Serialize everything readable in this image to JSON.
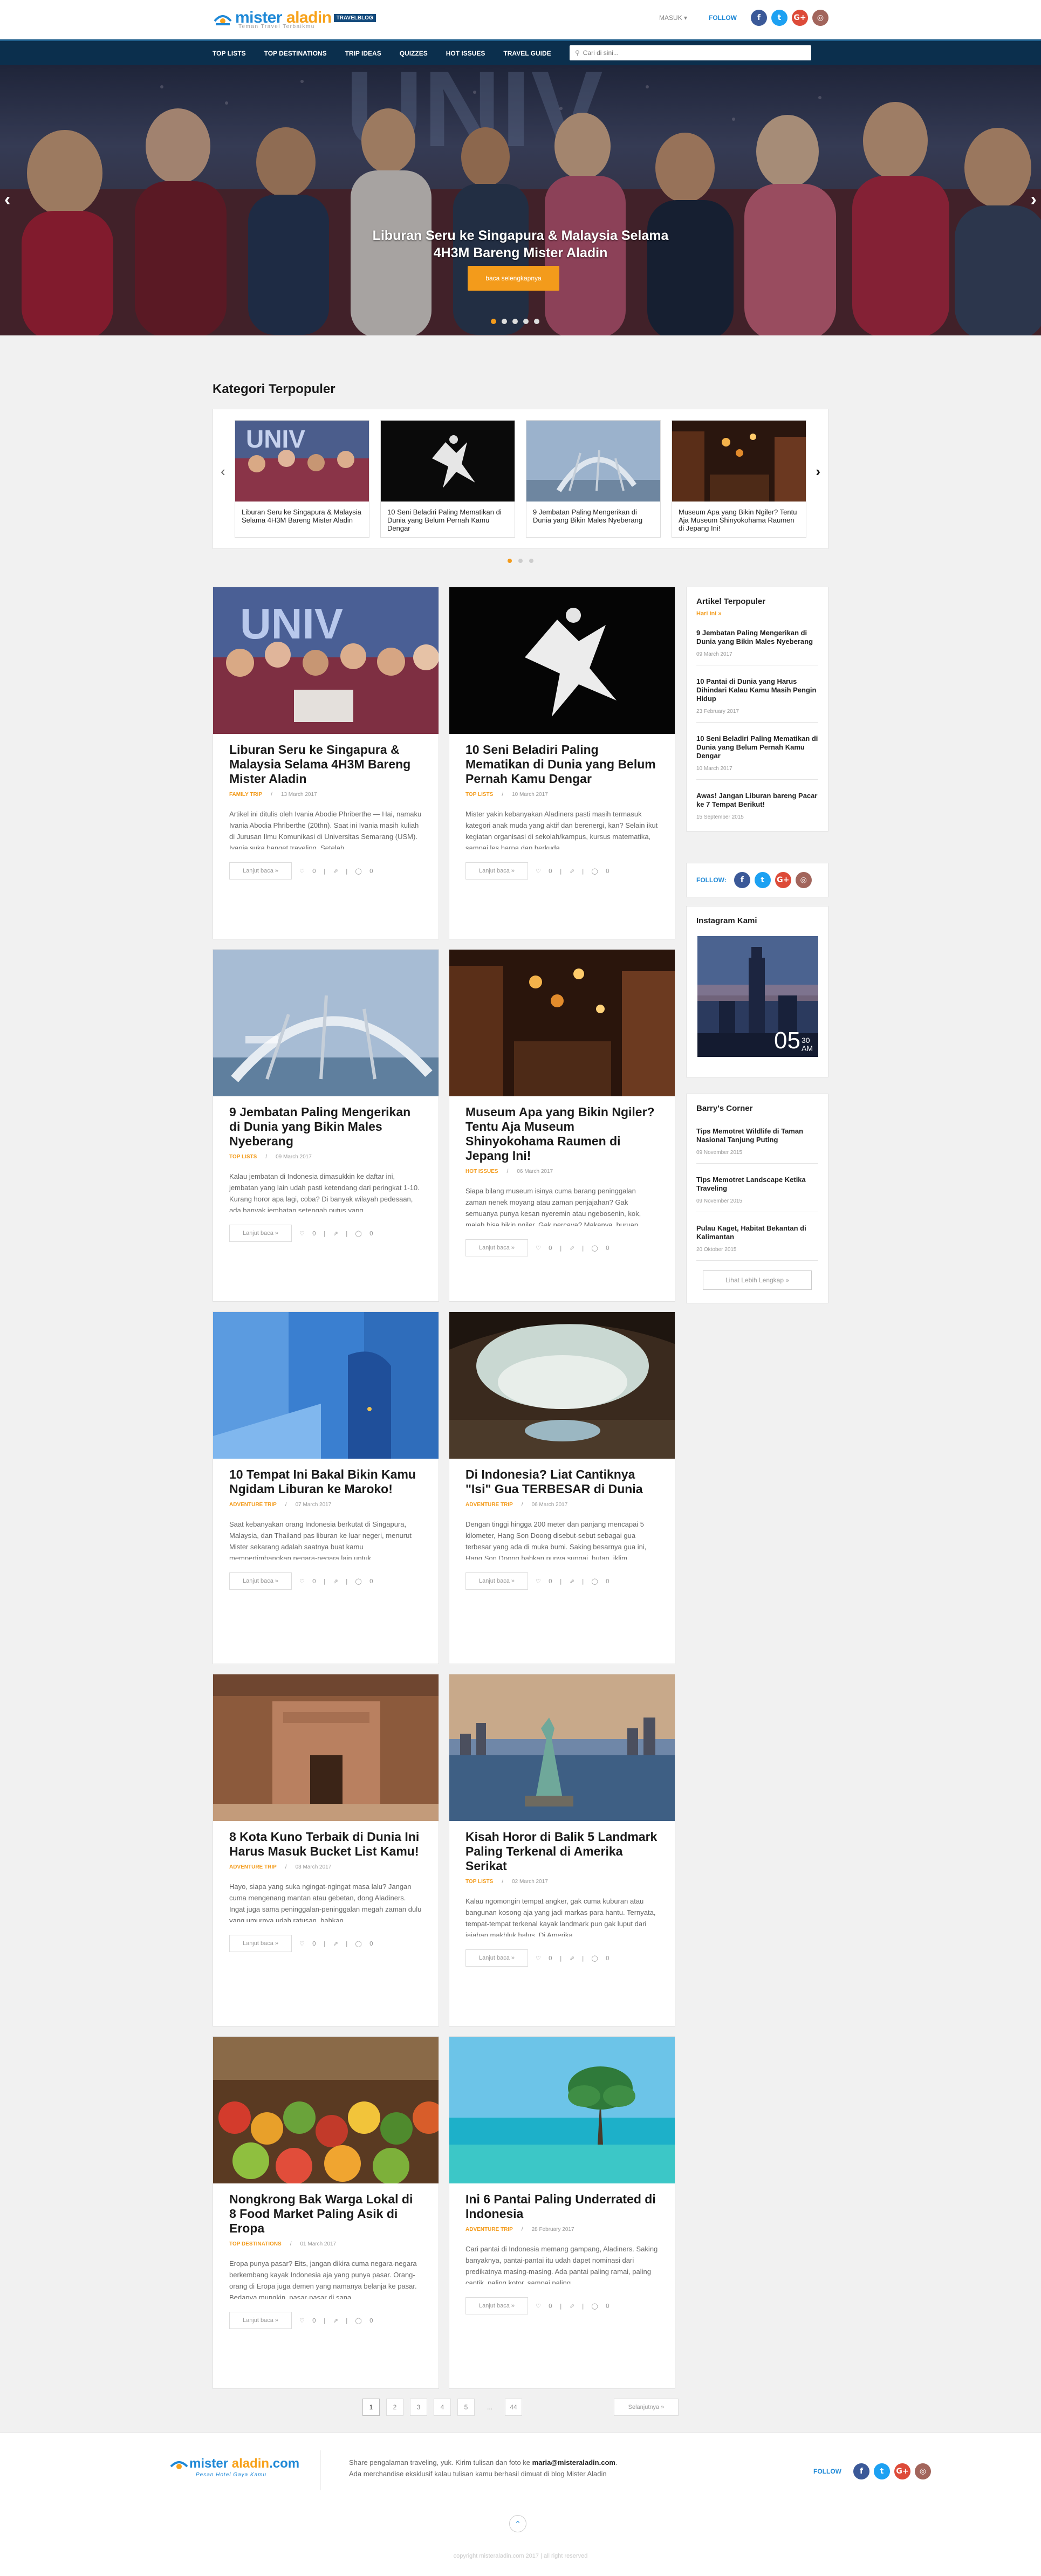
{
  "header": {
    "logo_brand_a": "mister",
    "logo_brand_b": "aladin",
    "logo_tag": "TRAVELBLOG",
    "logo_sub": "Teman Travel Terbaikmu",
    "login_label": "MASUK",
    "follow_label": "FOLLOW"
  },
  "nav": {
    "items": [
      "TOP LISTS",
      "TOP DESTINATIONS",
      "TRIP IDEAS",
      "QUIZZES",
      "HOT ISSUES",
      "TRAVEL GUIDE"
    ],
    "search_placeholder": "Cari di sini..."
  },
  "hero": {
    "title_line1": "Liburan Seru ke Singapura & Malaysia Selama",
    "title_line2": "4H3M Bareng Mister Aladin",
    "button_label": "baca selengkapnya",
    "slide_count": 5,
    "active_slide": 1
  },
  "kategori": {
    "title": "Kategori Terpopuler",
    "cards": [
      "Liburan Seru ke Singapura & Malaysia Selama 4H3M Bareng Mister Aladin",
      "10 Seni Beladiri Paling Mematikan di Dunia yang Belum Pernah Kamu Dengar",
      "9 Jembatan Paling Mengerikan di Dunia yang Bikin Males Nyeberang",
      "Museum Apa yang Bikin Ngiler? Tentu Aja Museum Shinyokohama Raumen di Jepang Ini!"
    ]
  },
  "posts": [
    {
      "title": "Liburan Seru ke Singapura & Malaysia Selama 4H3M Bareng Mister Aladin",
      "category": "FAMILY TRIP",
      "date": "13 March 2017",
      "excerpt": "Artikel ini ditulis oleh Ivania Abodie Phriberthe — Hai, namaku Ivania Abodia Phriberthe (20thn). Saat ini Ivania masih kuliah di Jurusan Ilmu Komunikasi di Universitas Semarang (USM). Ivania suka banget traveling. Setelah"
    },
    {
      "title": "10 Seni Beladiri Paling Mematikan di Dunia yang Belum Pernah Kamu Dengar",
      "category": "TOP LISTS",
      "date": "10 March 2017",
      "excerpt": "Mister yakin kebanyakan Aladiners pasti masih termasuk kategori anak muda yang aktif dan berenergi, kan? Selain ikut kegiatan organisasi di sekolah/kampus, kursus matematika, sampai les harpa dan berkuda"
    },
    {
      "title": "9 Jembatan Paling Mengerikan di Dunia yang Bikin Males Nyeberang",
      "category": "TOP LISTS",
      "date": "09 March 2017",
      "excerpt": "Kalau jembatan di Indonesia dimasukkin ke daftar ini, jembatan yang lain udah pasti ketendang dari peringkat 1-10. Kurang horor apa lagi, coba? Di banyak wilayah pedesaan, ada banyak jembatan setengah putus yang"
    },
    {
      "title": "Museum Apa yang Bikin Ngiler? Tentu Aja Museum Shinyokohama Raumen di Jepang Ini!",
      "category": "HOT ISSUES",
      "date": "06 March 2017",
      "excerpt": "Siapa bilang museum isinya cuma barang peninggalan zaman nenek moyang atau zaman penjajahan? Gak semuanya punya kesan nyeremin atau ngebosenin, kok, malah bisa bikin ngiler. Gak percaya? Makanya, buruan"
    },
    {
      "title": "10 Tempat Ini Bakal Bikin Kamu Ngidam Liburan ke Maroko!",
      "category": "ADVENTURE TRIP",
      "date": "07 March 2017",
      "excerpt": "Saat kebanyakan orang Indonesia berkutat di Singapura, Malaysia, dan Thailand pas liburan ke luar negeri, menurut Mister sekarang adalah saatnya buat kamu mempertimbangkan negara-negara lain untuk"
    },
    {
      "title": "Di Indonesia? Liat Cantiknya \"Isi\" Gua TERBESAR di Dunia",
      "category": "ADVENTURE TRIP",
      "date": "06 March 2017",
      "excerpt": "Dengan tinggi hingga 200 meter dan panjang mencapai 5 kilometer, Hang Son Doong disebut-sebut sebagai gua terbesar yang ada di muka bumi. Saking besarnya gua ini, Hang Son Doong bahkan punya sungai, hutan, iklim,"
    },
    {
      "title": "8 Kota Kuno Terbaik di Dunia Ini Harus Masuk Bucket List Kamu!",
      "category": "ADVENTURE TRIP",
      "date": "03 March 2017",
      "excerpt": "Hayo, siapa yang suka ngingat-ngingat masa lalu? Jangan cuma mengenang mantan atau gebetan, dong Aladiners. Ingat juga sama peninggalan-peninggalan megah zaman dulu yang umurnya udah ratusan, bahkan"
    },
    {
      "title": "Kisah Horor di Balik 5 Landmark Paling Terkenal di Amerika Serikat",
      "category": "TOP LISTS",
      "date": "02 March 2017",
      "excerpt": "Kalau ngomongin tempat angker, gak cuma kuburan atau bangunan kosong aja yang jadi markas para hantu. Ternyata, tempat-tempat terkenal kayak landmark pun gak luput dari jajahan makhluk halus. Di Amerika"
    },
    {
      "title": "Nongkrong Bak Warga Lokal di 8 Food Market Paling Asik di Eropa",
      "category": "TOP DESTINATIONS",
      "date": "01 March 2017",
      "excerpt": "Eropa punya pasar? Eits, jangan dikira cuma negara-negara berkembang kayak Indonesia aja yang punya pasar. Orang-orang di Eropa juga demen yang namanya belanja ke pasar. Bedanya mungkin, pasar-pasar di sana"
    },
    {
      "title": "Ini 6 Pantai Paling Underrated di Indonesia",
      "category": "ADVENTURE TRIP",
      "date": "28 February 2017",
      "excerpt": "Cari pantai di Indonesia memang gampang, Aladiners. Saking banyaknya, pantai-pantai itu udah dapet nominasi dari predikatnya masing-masing. Ada pantai paling ramai, paling cantik, paling kotor, sampai paling"
    }
  ],
  "post_ui": {
    "read_more": "Lanjut baca »",
    "like_count": "0",
    "comment_count": "0"
  },
  "sidebar": {
    "popular_title": "Artikel Terpopuler",
    "popular_more": "Hari ini »",
    "popular": [
      {
        "title": "9 Jembatan Paling Mengerikan di Dunia yang Bikin Males Nyeberang",
        "date": "09 March 2017"
      },
      {
        "title": "10 Pantai di Dunia yang Harus Dihindari Kalau Kamu Masih Pengin Hidup",
        "date": "23 February 2017"
      },
      {
        "title": "10 Seni Beladiri Paling Mematikan di Dunia yang Belum Pernah Kamu Dengar",
        "date": "10 March 2017"
      },
      {
        "title": "Awas! Jangan Liburan bareng Pacar ke 7 Tempat Berikut!",
        "date": "15 September 2015"
      }
    ],
    "follow_label": "FOLLOW:",
    "instagram_title": "Instagram Kami",
    "instagram_clock": "05",
    "instagram_clock_small": "30",
    "instagram_clock_ampm": "AM",
    "barry_title": "Barry's Corner",
    "barry": [
      {
        "title": "Tips Memotret Wildlife di Taman Nasional Tanjung Puting",
        "date": "09 November 2015"
      },
      {
        "title": "Tips Memotret Landscape Ketika Traveling",
        "date": "09 November 2015"
      },
      {
        "title": "Pulau Kaget, Habitat Bekantan di Kalimantan",
        "date": "20 Oktober 2015"
      }
    ],
    "barry_more": "Lihat Lebih Lengkap »"
  },
  "pagination": {
    "pages": [
      "1",
      "2",
      "3",
      "4",
      "5",
      "...",
      "44"
    ],
    "next": "Selanjutnya »"
  },
  "footer": {
    "brand_a": "mister",
    "brand_b": "aladin",
    "brand_c": ".com",
    "sub": "Pesan Hotel Gaya Kamu",
    "text_a": "Share pengalaman traveling, yuk. Kirim tulisan dan foto ke",
    "email": "maria@misteraladin.com",
    "text_b": ". Ada merchandise eksklusif kalau tulisan kamu berhasil dimuat di blog Mister Aladin",
    "follow_label": "FOLLOW",
    "copyright": "copyright misteraladin.com 2017 | all right reserved"
  },
  "colors": {
    "accent": "#f39b1b",
    "brand_blue": "#1e88d6",
    "nav_bg": "#0b2f4d"
  }
}
